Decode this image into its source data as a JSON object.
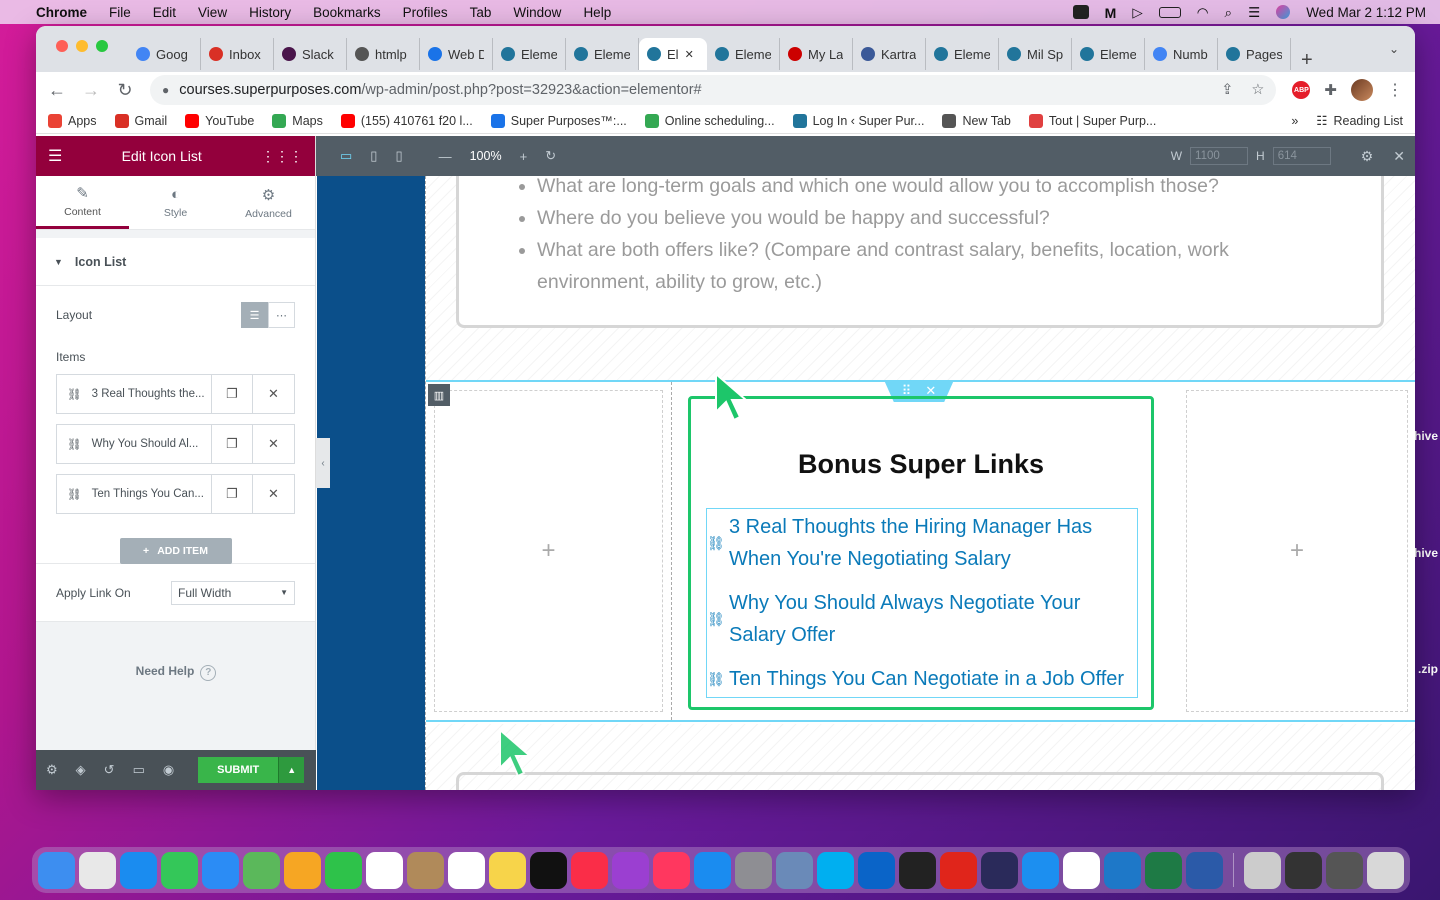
{
  "menubar": {
    "app": "Chrome",
    "items": [
      "File",
      "Edit",
      "View",
      "History",
      "Bookmarks",
      "Profiles",
      "Tab",
      "Window",
      "Help"
    ],
    "datetime": "Wed Mar 2  1:12 PM"
  },
  "desktop": {
    "labels": [
      "hive",
      "hive",
      ".zip"
    ]
  },
  "tabs": [
    {
      "title": "Goog",
      "icon": "google-icon",
      "color": "#4285f4"
    },
    {
      "title": "Inbox",
      "icon": "gmail-icon",
      "color": "#d93025"
    },
    {
      "title": "Slack",
      "icon": "slack-icon",
      "color": "#4a154b"
    },
    {
      "title": "htmlp",
      "icon": "web-icon",
      "color": "#555555"
    },
    {
      "title": "Web D",
      "icon": "web-icon",
      "color": "#1a73e8"
    },
    {
      "title": "Eleme",
      "icon": "wordpress-icon",
      "color": "#21759b"
    },
    {
      "title": "Eleme",
      "icon": "wordpress-icon",
      "color": "#21759b"
    },
    {
      "title": "El",
      "icon": "wordpress-icon",
      "color": "#21759b",
      "active": true
    },
    {
      "title": "Eleme",
      "icon": "wordpress-icon",
      "color": "#21759b"
    },
    {
      "title": "My La",
      "icon": "app-icon",
      "color": "#cc0000"
    },
    {
      "title": "Kartra",
      "icon": "kartra-icon",
      "color": "#3b5998"
    },
    {
      "title": "Eleme",
      "icon": "wordpress-icon",
      "color": "#21759b"
    },
    {
      "title": "Mil Sp",
      "icon": "wordpress-icon",
      "color": "#21759b"
    },
    {
      "title": "Eleme",
      "icon": "wordpress-icon",
      "color": "#21759b"
    },
    {
      "title": "Numb",
      "icon": "docs-icon",
      "color": "#4285f4"
    },
    {
      "title": "Pages",
      "icon": "wordpress-icon",
      "color": "#21759b"
    }
  ],
  "address": {
    "host": "courses.superpurposes.com",
    "path": "/wp-admin/post.php?post=32923&action=elementor#"
  },
  "bookmarks": [
    {
      "label": "Apps",
      "icon": "apps-grid-icon",
      "color": "#ea4335"
    },
    {
      "label": "Gmail",
      "icon": "gmail-icon",
      "color": "#d93025"
    },
    {
      "label": "YouTube",
      "icon": "youtube-icon",
      "color": "#ff0000"
    },
    {
      "label": "Maps",
      "icon": "maps-icon",
      "color": "#34a853"
    },
    {
      "label": "(155) 410761 f20 l...",
      "icon": "youtube-icon",
      "color": "#ff0000"
    },
    {
      "label": "Super Purposes™:...",
      "icon": "bookmark-icon",
      "color": "#1a73e8"
    },
    {
      "label": "Online scheduling...",
      "icon": "calendar-icon",
      "color": "#34a853"
    },
    {
      "label": "Log In ‹ Super Pur...",
      "icon": "wordpress-icon",
      "color": "#21759b"
    },
    {
      "label": "New Tab",
      "icon": "globe-icon",
      "color": "#555555"
    },
    {
      "label": "Tout | Super Purp...",
      "icon": "tout-icon",
      "color": "#e04040"
    }
  ],
  "reading_list": "Reading List",
  "panel": {
    "title": "Edit Icon List",
    "tabs": [
      "Content",
      "Style",
      "Advanced"
    ],
    "section": "Icon List",
    "layout_label": "Layout",
    "items_label": "Items",
    "items": [
      "3 Real Thoughts the...",
      "Why You Should Al...",
      "Ten Things You Can..."
    ],
    "add_item": "ADD ITEM",
    "apply_link_label": "Apply Link On",
    "apply_link_value": "Full Width",
    "need_help": "Need Help",
    "submit": "SUBMIT"
  },
  "topbar": {
    "zoom": "100%",
    "w_label": "W",
    "w_value": "1100",
    "h_label": "H",
    "h_value": "614"
  },
  "content": {
    "bullets": [
      "What are long-term goals and which one would allow you to accomplish those?",
      "Where do you believe you would be happy and successful?",
      "What are both offers like? (Compare and contrast salary, benefits, location, work environment, ability to grow, etc.)"
    ],
    "bonus_title": "Bonus Super Links",
    "links": [
      "3 Real Thoughts the Hiring Manager Has When You're Negotiating Salary",
      "Why You Should Always Negotiate Your Salary Offer",
      "Ten Things You Can Negotiate in a Job Offer"
    ]
  },
  "dock": [
    {
      "name": "finder-icon",
      "color": "#3d8ef0"
    },
    {
      "name": "launchpad-icon",
      "color": "#e8e8e8"
    },
    {
      "name": "safari-icon",
      "color": "#1a8cf0"
    },
    {
      "name": "messages-icon",
      "color": "#34c759"
    },
    {
      "name": "mail-icon",
      "color": "#2b8cf5"
    },
    {
      "name": "maps-icon",
      "color": "#5bb85b"
    },
    {
      "name": "photos-icon",
      "color": "#f6a623"
    },
    {
      "name": "facetime-icon",
      "color": "#2ec24a"
    },
    {
      "name": "calendar-icon",
      "color": "#ffffff"
    },
    {
      "name": "contacts-icon",
      "color": "#b08a5a"
    },
    {
      "name": "reminders-icon",
      "color": "#ffffff"
    },
    {
      "name": "notes-icon",
      "color": "#f7d44a"
    },
    {
      "name": "appletv-icon",
      "color": "#111111"
    },
    {
      "name": "music-icon",
      "color": "#fa2d48"
    },
    {
      "name": "podcasts-icon",
      "color": "#9b3fd1"
    },
    {
      "name": "news-icon",
      "color": "#ff375f"
    },
    {
      "name": "appstore-icon",
      "color": "#1a8cf0"
    },
    {
      "name": "system-preferences-icon",
      "color": "#8e8e93"
    },
    {
      "name": "preview-icon",
      "color": "#6a8ab8"
    },
    {
      "name": "skype-icon",
      "color": "#00aff0"
    },
    {
      "name": "outlook-icon",
      "color": "#0a64c8"
    },
    {
      "name": "terminal-icon",
      "color": "#222222"
    },
    {
      "name": "acrobat-icon",
      "color": "#e0251b"
    },
    {
      "name": "app-icon",
      "color": "#2a2a5a"
    },
    {
      "name": "xcode-icon",
      "color": "#1c8ff0"
    },
    {
      "name": "chrome-icon",
      "color": "#ffffff"
    },
    {
      "name": "vscode-icon",
      "color": "#1e78c8"
    },
    {
      "name": "excel-icon",
      "color": "#1e7a45"
    },
    {
      "name": "word-icon",
      "color": "#2b5aa8"
    },
    {
      "name": "photo-thumbnail-icon",
      "color": "#cccccc"
    },
    {
      "name": "window-thumbnail-icon",
      "color": "#333333"
    },
    {
      "name": "window-thumbnail-icon",
      "color": "#555555"
    },
    {
      "name": "trash-icon",
      "color": "#d8d8d8"
    }
  ]
}
